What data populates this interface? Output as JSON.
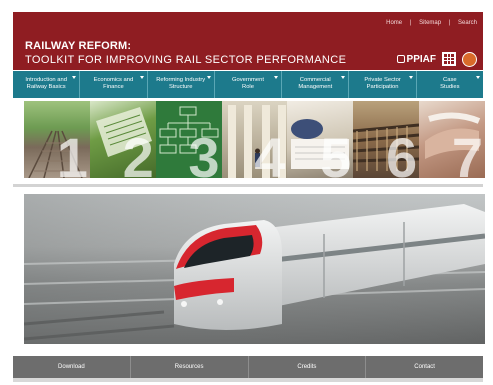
{
  "header": {
    "title_line1": "RAILWAY REFORM:",
    "title_line2": "TOOLKIT FOR IMPROVING RAIL SECTOR PERFORMANCE",
    "links": [
      "Home",
      "Sitemap",
      "Search"
    ],
    "link_separator": "|",
    "logo_text": "PPIAF",
    "brand_color": "#8f1d22"
  },
  "nav": {
    "color": "#1d7a8c",
    "items": [
      {
        "line1": "Introduction and",
        "line2": "Railway Basics"
      },
      {
        "line1": "Economics and",
        "line2": "Finance"
      },
      {
        "line1": "Reforming Industry",
        "line2": "Structure"
      },
      {
        "line1": "Government",
        "line2": "Role"
      },
      {
        "line1": "Commercial",
        "line2": "Management"
      },
      {
        "line1": "Private Sector",
        "line2": "Participation"
      },
      {
        "line1": "Case",
        "line2": "Studies"
      }
    ]
  },
  "strip": {
    "numbers": [
      "1",
      "2",
      "3",
      "4",
      "5",
      "6",
      "7"
    ]
  },
  "footer_nav": {
    "items": [
      "Download",
      "Resources",
      "Credits",
      "Contact"
    ]
  }
}
